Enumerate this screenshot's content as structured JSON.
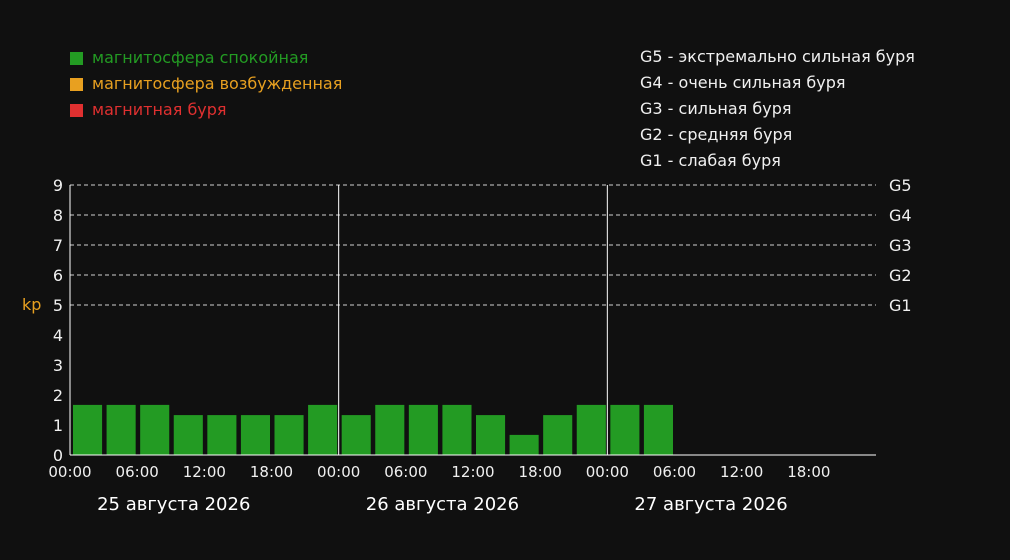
{
  "chart_data": {
    "type": "bar",
    "ylabel": "kp",
    "ylim": [
      0,
      9
    ],
    "yticks": [
      "0",
      "1",
      "2",
      "3",
      "4",
      "5",
      "6",
      "7",
      "8",
      "9"
    ],
    "grid": "dashed at kp 5-9",
    "storm_levels": [
      {
        "level": 5,
        "label": "G1"
      },
      {
        "level": 6,
        "label": "G2"
      },
      {
        "level": 7,
        "label": "G3"
      },
      {
        "level": 8,
        "label": "G4"
      },
      {
        "level": 9,
        "label": "G5"
      }
    ],
    "days": [
      {
        "label": "25 августа 2026",
        "ticks": [
          "00:00",
          "06:00",
          "12:00",
          "18:00"
        ],
        "values": [
          1.67,
          1.67,
          1.67,
          1.33,
          1.33,
          1.33,
          1.33,
          1.67
        ]
      },
      {
        "label": "26 августа 2026",
        "ticks": [
          "00:00",
          "06:00",
          "12:00",
          "18:00"
        ],
        "values": [
          1.33,
          1.67,
          1.67,
          1.67,
          1.33,
          0.67,
          1.33,
          1.67
        ]
      },
      {
        "label": "27 августа 2026",
        "ticks": [
          "00:00",
          "06:00",
          "12:00",
          "18:00"
        ],
        "values": [
          1.67,
          1.67
        ]
      }
    ],
    "bar_color": "#239b23"
  },
  "legend": [
    {
      "label": "магнитосфера спокойная",
      "color": "#239b23"
    },
    {
      "label": "магнитосфера возбужденная",
      "color": "#e8a020"
    },
    {
      "label": "магнитная буря",
      "color": "#e03030"
    }
  ],
  "scale_legend": [
    "G5 - экстремально сильная буря",
    "G4 - очень сильная буря",
    "G3 - сильная буря",
    "G2 - средняя буря",
    "G1 - слабая буря"
  ],
  "ylabel_color": "#e8a020"
}
